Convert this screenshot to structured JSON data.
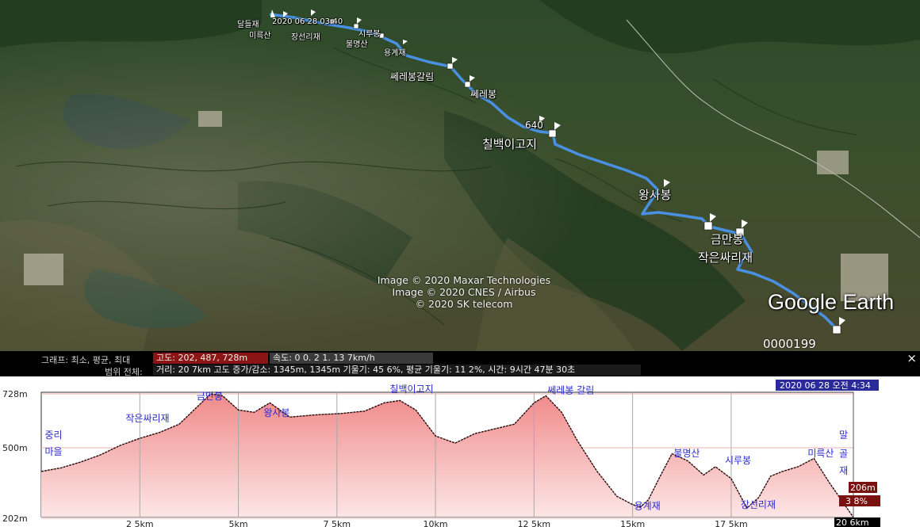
{
  "map": {
    "labels": [
      {
        "text": "달들재",
        "size": "small"
      },
      {
        "text": "2020 06 28 03:40",
        "size": "small"
      },
      {
        "text": "미륵산",
        "size": "small"
      },
      {
        "text": "장선리재",
        "size": "small"
      },
      {
        "text": "시루봉",
        "size": "small"
      },
      {
        "text": "불명산",
        "size": "small"
      },
      {
        "text": "용계재",
        "size": "small"
      },
      {
        "text": "쎄레봉갈림",
        "size": "mid"
      },
      {
        "text": "쎄레봉",
        "size": "mid"
      },
      {
        "text": "640",
        "size": "mid"
      },
      {
        "text": "칠백이고지",
        "size": "big"
      },
      {
        "text": "왕사봉",
        "size": "big"
      },
      {
        "text": "금만봉",
        "size": "big"
      },
      {
        "text": "작은싸리재",
        "size": "big"
      }
    ],
    "attribution": [
      "Image © 2020 Maxar Technologies",
      "Image © 2020 CNES / Airbus",
      "© 2020 SK telecom"
    ],
    "logo": "Google Earth",
    "frame_counter": "0000199"
  },
  "stats": {
    "graph_label": "그래프: 최소, 평균, 최대",
    "range_label": "범위 전체:",
    "elevation": "고도: 202, 487, 728m",
    "speed": "속도: 0    0. 2    1. 13    7km/h",
    "summary": "거리: 20    7km 고도 증가/감소: 1345m,    1345m 기울기: 45    6%, 평균 기울기: 11    2%, 시간: 9시간 47분 30초",
    "close": "×",
    "colors": {
      "elevation_box": "#8b1414",
      "speed_box": "#3a3a3a",
      "summary_box": "#1a1a1a"
    }
  },
  "profile": {
    "timestamp": "2020 06 28 오전 4:34",
    "cursor_elevation": "206m",
    "cursor_grade": "3    8%",
    "cursor_distance": "20    6km",
    "y_ticks": [
      {
        "label": "728m",
        "value": 728
      },
      {
        "label": "500m",
        "value": 500
      },
      {
        "label": "202m",
        "value": 202
      }
    ],
    "x_ticks": [
      {
        "label": "2    5km",
        "value": 2.5
      },
      {
        "label": "5km",
        "value": 5
      },
      {
        "label": "7    5km",
        "value": 7.5
      },
      {
        "label": "10km",
        "value": 10
      },
      {
        "label": "12    5km",
        "value": 12.5
      },
      {
        "label": "15km",
        "value": 15
      },
      {
        "label": "17    5km",
        "value": 17.5
      }
    ],
    "annotations": [
      {
        "text": "중리",
        "pos": [
          0.05,
          540
        ]
      },
      {
        "text": "마을",
        "pos": [
          0.05,
          470
        ]
      },
      {
        "text": "작은싸리재",
        "pos": [
          2.1,
          610
        ]
      },
      {
        "text": "금만봉",
        "pos": [
          3.9,
          705
        ]
      },
      {
        "text": "왕사봉",
        "pos": [
          5.6,
          635
        ]
      },
      {
        "text": "칠백이고지",
        "pos": [
          8.8,
          735
        ]
      },
      {
        "text": "쎄레봉 갈림",
        "pos": [
          12.8,
          730
        ]
      },
      {
        "text": "용계재",
        "pos": [
          15.0,
          240
        ]
      },
      {
        "text": "불명산",
        "pos": [
          16.0,
          463
        ]
      },
      {
        "text": "시루봉",
        "pos": [
          17.3,
          433
        ]
      },
      {
        "text": "장선리재",
        "pos": [
          17.7,
          245
        ]
      },
      {
        "text": "미륵산",
        "pos": [
          19.4,
          463
        ]
      },
      {
        "text": "말",
        "pos": [
          20.2,
          540
        ]
      },
      {
        "text": "골",
        "pos": [
          20.2,
          462
        ]
      },
      {
        "text": "재",
        "pos": [
          20.2,
          390
        ]
      }
    ],
    "x_max": 20.6,
    "colors": {
      "fill_top": "#f08a8a",
      "fill_bottom": "#fde6e6",
      "line": "#2a0a0a",
      "label": "#2a2ad0",
      "grid": "#a8a8a8",
      "timestamp_bg": "#2a2a9a",
      "cursor_bg": "#7a1010"
    }
  },
  "chart_data": {
    "type": "area",
    "title": "",
    "xlabel": "",
    "ylabel": "",
    "xlim": [
      0,
      20.6
    ],
    "ylim": [
      202,
      728
    ],
    "x": [
      0,
      0.5,
      1.0,
      1.5,
      2.0,
      2.5,
      3.0,
      3.5,
      4.0,
      4.3,
      4.6,
      5.0,
      5.4,
      5.8,
      6.3,
      7.0,
      7.6,
      8.2,
      8.7,
      9.1,
      9.5,
      10.0,
      10.5,
      11.0,
      11.5,
      12.0,
      12.5,
      12.8,
      13.2,
      13.6,
      14.1,
      14.6,
      15.0,
      15.2,
      15.4,
      15.7,
      16.0,
      16.4,
      16.8,
      17.1,
      17.5,
      17.9,
      18.2,
      18.5,
      18.8,
      19.2,
      19.6,
      20.0,
      20.6
    ],
    "series": [
      {
        "values": [
          400,
          415,
          440,
          470,
          510,
          540,
          565,
          600,
          680,
          728,
          720,
          660,
          650,
          690,
          630,
          640,
          645,
          655,
          690,
          700,
          660,
          550,
          520,
          560,
          580,
          600,
          690,
          720,
          650,
          530,
          400,
          295,
          260,
          250,
          280,
          380,
          475,
          445,
          385,
          420,
          370,
          245,
          290,
          380,
          400,
          420,
          455,
          350,
          206
        ]
      }
    ]
  }
}
